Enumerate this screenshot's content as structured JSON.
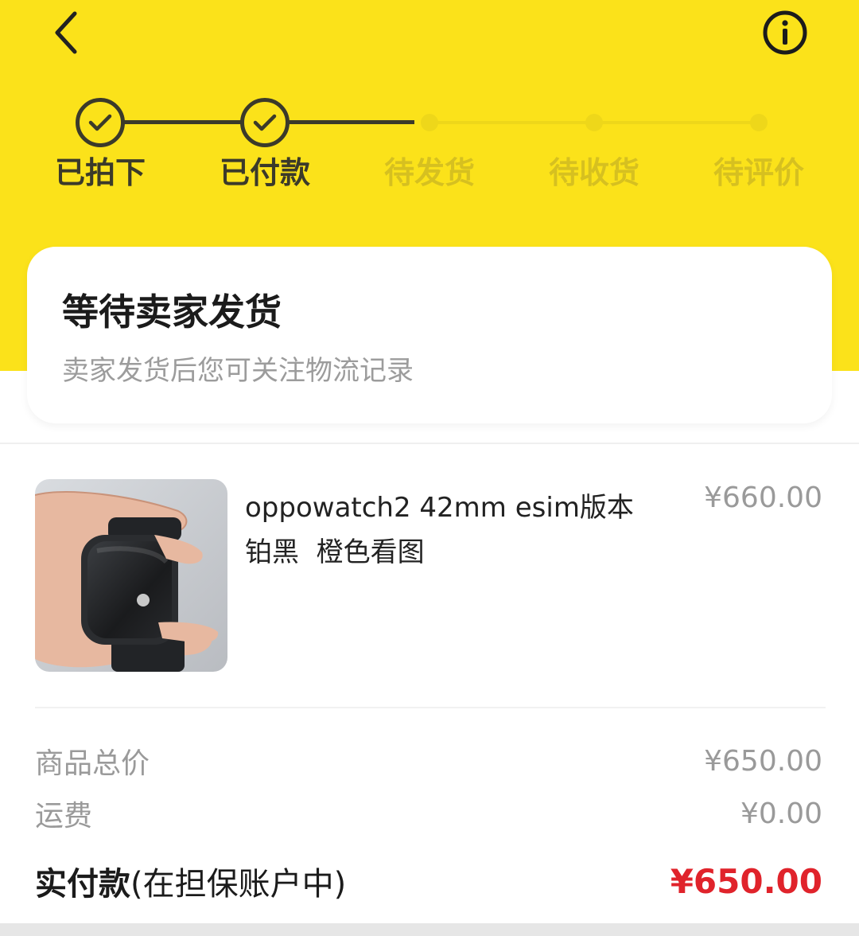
{
  "header": {
    "back_icon": "chevron-left-icon",
    "info_icon": "info-circle-icon"
  },
  "colors": {
    "brand_yellow": "#fbe21a",
    "step_done": "#3b3a2a",
    "step_todo": "#d6c020",
    "price_red": "#e0232b"
  },
  "steps": [
    {
      "label": "已拍下",
      "done": true
    },
    {
      "label": "已付款",
      "done": true
    },
    {
      "label": "待发货",
      "done": false
    },
    {
      "label": "待收货",
      "done": false
    },
    {
      "label": "待评价",
      "done": false
    }
  ],
  "status": {
    "title": "等待卖家发货",
    "subtitle": "卖家发货后您可关注物流记录"
  },
  "product": {
    "name_line1": "oppowatch2 42mm esim版本",
    "name_line2": "铂黑  橙色看图",
    "price": "¥660.00"
  },
  "summary": {
    "goods_total_label": "商品总价",
    "goods_total_value": "¥650.00",
    "shipping_label": "运费",
    "shipping_value": "¥0.00",
    "paid_label": "实付款",
    "paid_note": "(在担保账户中)",
    "paid_value": "¥650.00"
  }
}
